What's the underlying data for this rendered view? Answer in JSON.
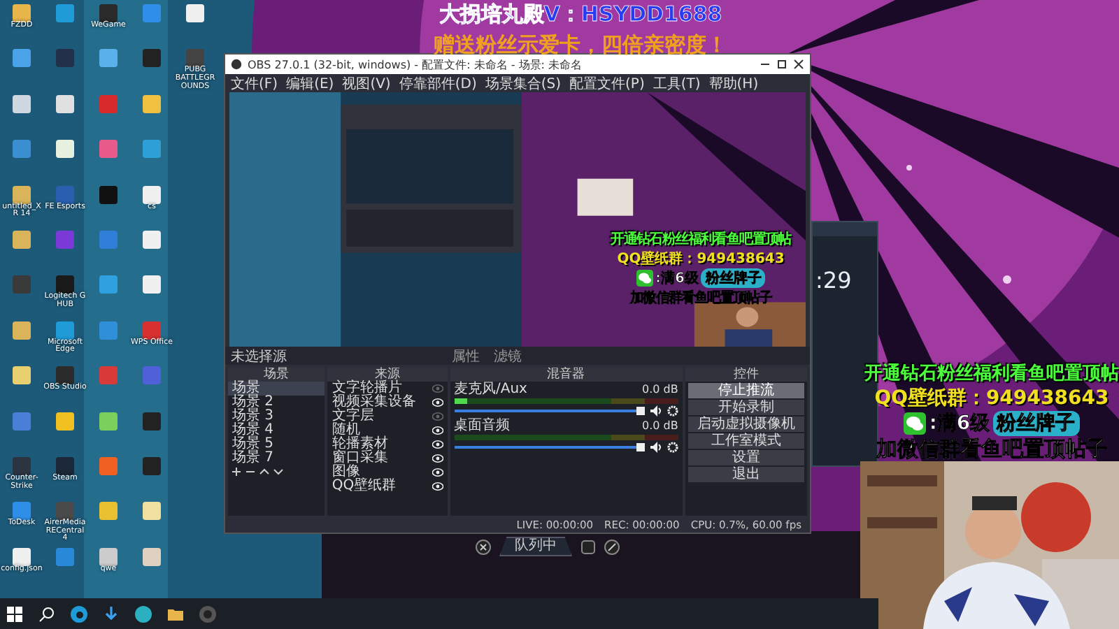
{
  "overlay_top": {
    "title": "大拐培丸殿V：HSYDD1688",
    "subtitle": "赠送粉丝示爱卡，四倍亲密度！"
  },
  "desktop_columns": [
    [
      {
        "color": "#e8b64a",
        "label": "FZDD"
      },
      {
        "color": "#4aa3e8"
      },
      {
        "color": "#cfd8e0"
      },
      {
        "color": "#3a8fd0"
      },
      {
        "color": "#d9b45a",
        "label": "untitled_XR 14"
      },
      {
        "color": "#d9b45a"
      },
      {
        "color": "#3a3a3a"
      },
      {
        "color": "#d9b45a"
      },
      {
        "color": "#e8d070"
      },
      {
        "color": "#4a7fd8"
      },
      {
        "color": "#2b3440",
        "label": "Counter-Strike"
      },
      {
        "color": "#2f8fe8",
        "label": "ToDesk"
      },
      {
        "color": "#f0f0f0",
        "label": "config.json"
      }
    ],
    [
      {
        "color": "#1f9bd8"
      },
      {
        "color": "#22304a"
      },
      {
        "color": "#e0e0e0"
      },
      {
        "color": "#e8f0e0"
      },
      {
        "color": "#2a5fb0",
        "label": "FE Esports"
      },
      {
        "color": "#7a3ad8"
      },
      {
        "color": "#1a1a1a",
        "label": "Logitech G HUB"
      },
      {
        "color": "#1f9bd8",
        "label": "Microsoft Edge"
      },
      {
        "color": "#2b2b2b",
        "label": "OBS Studio"
      },
      {
        "color": "#f0c020"
      },
      {
        "color": "#1b2838",
        "label": "Steam"
      },
      {
        "color": "#4a4a4a",
        "label": "AirerMedia RECentral 4"
      },
      {
        "color": "#2a88d8"
      }
    ],
    [
      {
        "color": "#2a2a2a",
        "label": "WeGame"
      },
      {
        "color": "#5ab0e8"
      },
      {
        "color": "#d82a2a"
      },
      {
        "color": "#e85a8a"
      },
      {
        "color": "#111111"
      },
      {
        "color": "#2f7fd8"
      },
      {
        "color": "#2fa0e0"
      },
      {
        "color": "#2f8fd8"
      },
      {
        "color": "#d83a3a"
      },
      {
        "color": "#7ad05a"
      },
      {
        "color": "#f06020"
      },
      {
        "color": "#e8c030"
      },
      {
        "color": "#cccccc",
        "label": "qwe"
      }
    ],
    [
      {
        "color": "#2f8fe8"
      },
      {
        "color": "#222222"
      },
      {
        "color": "#f0c040"
      },
      {
        "color": "#2f9fd8"
      },
      {
        "color": "#f0f0f0",
        "label": "cs"
      },
      {
        "color": "#f0f0f0"
      },
      {
        "color": "#f0f0f0"
      },
      {
        "color": "#d83030",
        "label": "WPS Office"
      },
      {
        "color": "#5060d8"
      },
      {
        "color": "#222222"
      },
      {
        "color": "#222222"
      },
      {
        "color": "#f0e0a0"
      },
      {
        "color": "#e0d0c0"
      }
    ],
    [
      {
        "color": "#f0f0f0"
      },
      {
        "color": "#444444",
        "label": "PUBG BATTLEGROUNDS"
      }
    ]
  ],
  "obs": {
    "title": "OBS 27.0.1 (32-bit, windows) - 配置文件: 未命名 - 场景: 未命名",
    "menu": [
      "文件(F)",
      "编辑(E)",
      "视图(V)",
      "停靠部件(D)",
      "场景集合(S)",
      "配置文件(P)",
      "工具(T)",
      "帮助(H)"
    ],
    "preview_overlay": {
      "promo": "开通钻石粉丝福利看鱼吧置顶帖",
      "qq": "QQ壁纸群：949438643",
      "level": ":满6级",
      "badge": "粉丝牌子",
      "footer": "加微信群看鱼吧置顶帖子"
    },
    "source_bar": {
      "label": "未选择源",
      "buttons": [
        "属性",
        "滤镜"
      ]
    },
    "scenes": {
      "title": "场景",
      "items": [
        {
          "label": "场景",
          "selected": true
        },
        {
          "label": "场景 2",
          "selected": false
        },
        {
          "label": "场景 3",
          "selected": false
        },
        {
          "label": "场景 4",
          "selected": false
        },
        {
          "label": "场景 5",
          "selected": false
        },
        {
          "label": "场景 7",
          "selected": false
        }
      ]
    },
    "sources": {
      "title": "来源",
      "items": [
        {
          "label": "文字轮播片",
          "visible": false
        },
        {
          "label": "视频采集设备",
          "visible": true
        },
        {
          "label": "文字层",
          "visible": false
        },
        {
          "label": "随机",
          "visible": true
        },
        {
          "label": "轮播素材",
          "visible": true
        },
        {
          "label": "窗口采集",
          "visible": true
        },
        {
          "label": "图像",
          "visible": true
        },
        {
          "label": "QQ壁纸群",
          "visible": true
        }
      ]
    },
    "mixer": {
      "title": "混音器",
      "channels": [
        {
          "name": "麦克风/Aux",
          "reading": "0.0 dB",
          "meter": {
            "level": 0.06
          },
          "volume": {
            "level": 1
          }
        },
        {
          "name": "桌面音频",
          "reading": "0.0 dB",
          "meter": {
            "level": 0
          },
          "volume": {
            "level": 1
          }
        }
      ]
    },
    "controls": {
      "title": "控件",
      "buttons": [
        {
          "label": "停止推流",
          "selected": true
        },
        {
          "label": "开始录制",
          "selected": false
        },
        {
          "label": "启动虚拟摄像机",
          "selected": false
        },
        {
          "label": "工作室模式",
          "selected": false
        },
        {
          "label": "设置",
          "selected": false
        },
        {
          "label": "退出",
          "selected": false
        }
      ]
    },
    "status": {
      "live": "LIVE: 00:00:00",
      "rec": "REC: 00:00:00",
      "cpu": "CPU: 0.7%, 60.00 fps"
    }
  },
  "chat_window": {
    "time": ":29"
  },
  "queue_bar": {
    "label": "队列中"
  },
  "overlay_right": {
    "promo": "开通钻石粉丝福利看鱼吧置顶帖",
    "qq": "QQ壁纸群：949438643",
    "level": ":满6级",
    "badge": "粉丝牌子",
    "footer": "加微信群看鱼吧置顶帖子"
  }
}
